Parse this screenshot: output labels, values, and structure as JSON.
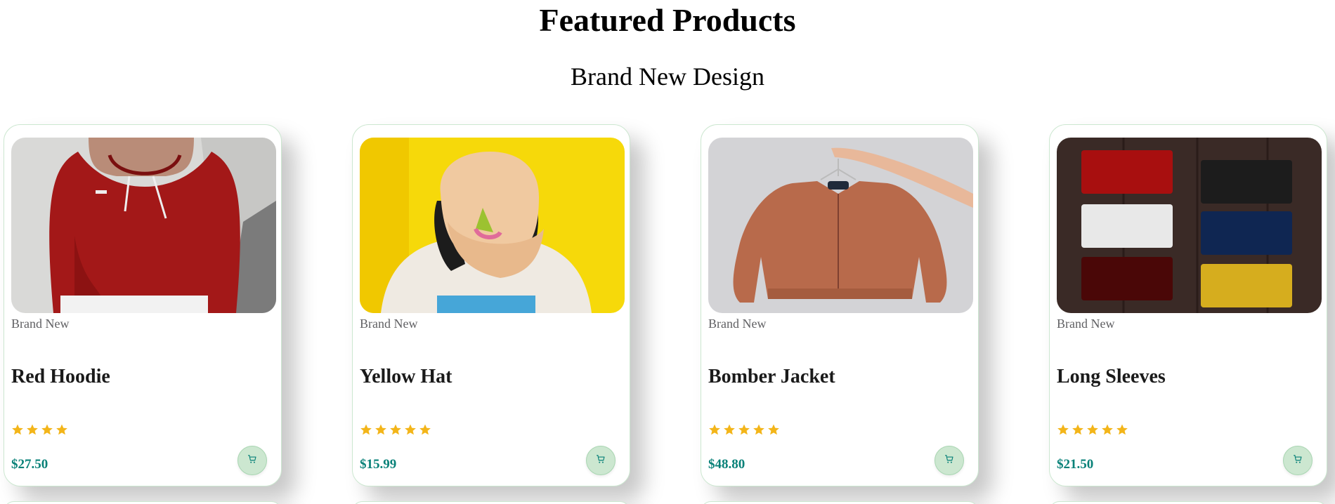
{
  "section": {
    "title": "Featured Products",
    "subtitle": "Brand New Design"
  },
  "colors": {
    "price": "#088178",
    "star": "#f3b519",
    "cart_bg": "#cce7d0"
  },
  "products": [
    {
      "brand": "Brand New",
      "name": "Red Hoodie",
      "rating": 4,
      "price": "$27.50",
      "image": "red-hoodie-photo",
      "cart_icon": "cart-icon"
    },
    {
      "brand": "Brand New",
      "name": "Yellow Hat",
      "rating": 5,
      "price": "$15.99",
      "image": "yellow-hat-photo",
      "cart_icon": "cart-icon"
    },
    {
      "brand": "Brand New",
      "name": "Bomber Jacket",
      "rating": 5,
      "price": "$48.80",
      "image": "bomber-jacket-photo",
      "cart_icon": "cart-icon"
    },
    {
      "brand": "Brand New",
      "name": "Long Sleeves",
      "rating": 5,
      "price": "$21.50",
      "image": "long-sleeves-photo",
      "cart_icon": "cart-icon"
    }
  ]
}
